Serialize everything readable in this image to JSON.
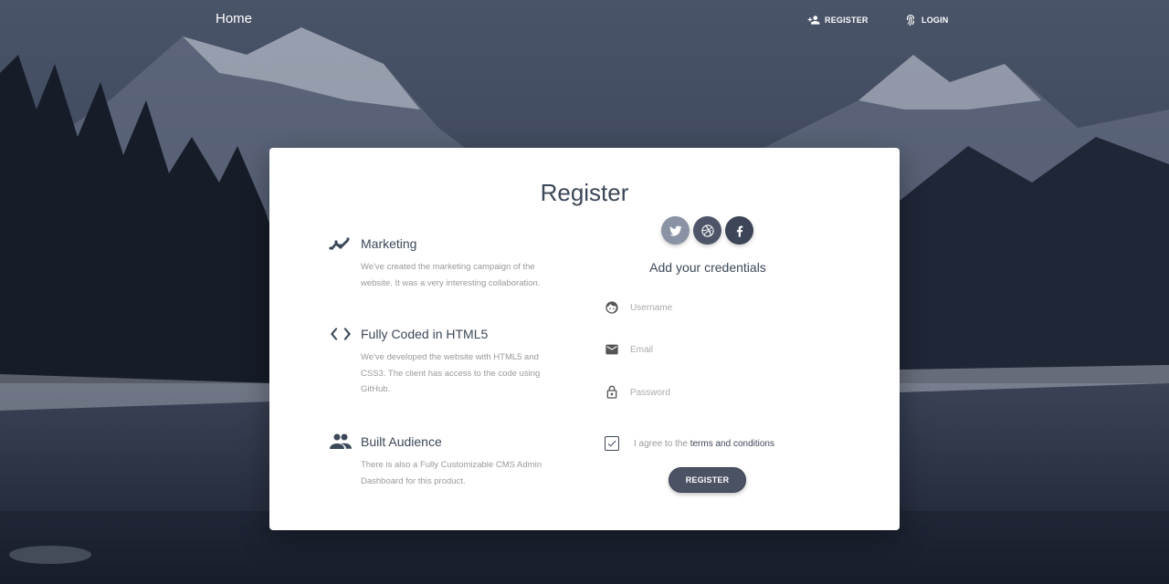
{
  "navbar": {
    "brand": "Home",
    "links": [
      {
        "label": "REGISTER",
        "icon": "person-add-icon"
      },
      {
        "label": "LOGIN",
        "icon": "fingerprint-icon"
      }
    ]
  },
  "card": {
    "title": "Register",
    "info": [
      {
        "icon": "timeline-icon",
        "title": "Marketing",
        "description": "We've created the marketing campaign of the website. It was a very interesting collaboration."
      },
      {
        "icon": "code-icon",
        "title": "Fully Coded in HTML5",
        "description": "We've developed the website with HTML5 and CSS3. The client has access to the code using GitHub."
      },
      {
        "icon": "group-icon",
        "title": "Built Audience",
        "description": "There is also a Fully Customizable CMS Admin Dashboard for this product."
      }
    ],
    "social": [
      "twitter-icon",
      "dribbble-icon",
      "facebook-icon"
    ],
    "credentials_label": "Add your credentials",
    "form": {
      "username_placeholder": "Username",
      "email_placeholder": "Email",
      "password_placeholder": "Password",
      "terms_prefix": "I agree to the ",
      "terms_link": "terms and conditions",
      "terms_checked": true,
      "submit_label": "REGISTER"
    }
  },
  "colors": {
    "primary": "#3c4858",
    "button": "#4b5264",
    "background": "#2a3346"
  }
}
